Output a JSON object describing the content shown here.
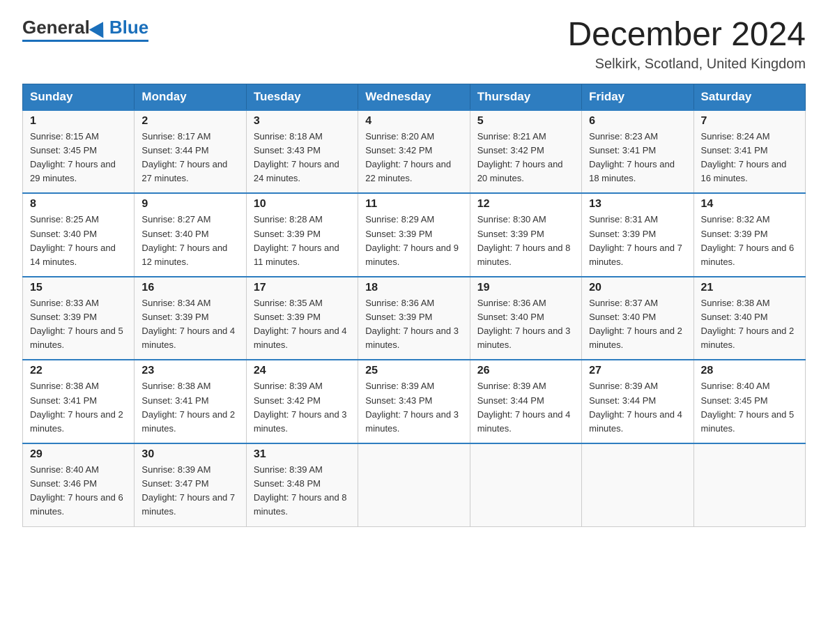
{
  "header": {
    "logo_general": "General",
    "logo_blue": "Blue",
    "main_title": "December 2024",
    "subtitle": "Selkirk, Scotland, United Kingdom"
  },
  "days_of_week": [
    "Sunday",
    "Monday",
    "Tuesday",
    "Wednesday",
    "Thursday",
    "Friday",
    "Saturday"
  ],
  "weeks": [
    [
      {
        "day": "1",
        "sunrise": "8:15 AM",
        "sunset": "3:45 PM",
        "daylight": "7 hours and 29 minutes."
      },
      {
        "day": "2",
        "sunrise": "8:17 AM",
        "sunset": "3:44 PM",
        "daylight": "7 hours and 27 minutes."
      },
      {
        "day": "3",
        "sunrise": "8:18 AM",
        "sunset": "3:43 PM",
        "daylight": "7 hours and 24 minutes."
      },
      {
        "day": "4",
        "sunrise": "8:20 AM",
        "sunset": "3:42 PM",
        "daylight": "7 hours and 22 minutes."
      },
      {
        "day": "5",
        "sunrise": "8:21 AM",
        "sunset": "3:42 PM",
        "daylight": "7 hours and 20 minutes."
      },
      {
        "day": "6",
        "sunrise": "8:23 AM",
        "sunset": "3:41 PM",
        "daylight": "7 hours and 18 minutes."
      },
      {
        "day": "7",
        "sunrise": "8:24 AM",
        "sunset": "3:41 PM",
        "daylight": "7 hours and 16 minutes."
      }
    ],
    [
      {
        "day": "8",
        "sunrise": "8:25 AM",
        "sunset": "3:40 PM",
        "daylight": "7 hours and 14 minutes."
      },
      {
        "day": "9",
        "sunrise": "8:27 AM",
        "sunset": "3:40 PM",
        "daylight": "7 hours and 12 minutes."
      },
      {
        "day": "10",
        "sunrise": "8:28 AM",
        "sunset": "3:39 PM",
        "daylight": "7 hours and 11 minutes."
      },
      {
        "day": "11",
        "sunrise": "8:29 AM",
        "sunset": "3:39 PM",
        "daylight": "7 hours and 9 minutes."
      },
      {
        "day": "12",
        "sunrise": "8:30 AM",
        "sunset": "3:39 PM",
        "daylight": "7 hours and 8 minutes."
      },
      {
        "day": "13",
        "sunrise": "8:31 AM",
        "sunset": "3:39 PM",
        "daylight": "7 hours and 7 minutes."
      },
      {
        "day": "14",
        "sunrise": "8:32 AM",
        "sunset": "3:39 PM",
        "daylight": "7 hours and 6 minutes."
      }
    ],
    [
      {
        "day": "15",
        "sunrise": "8:33 AM",
        "sunset": "3:39 PM",
        "daylight": "7 hours and 5 minutes."
      },
      {
        "day": "16",
        "sunrise": "8:34 AM",
        "sunset": "3:39 PM",
        "daylight": "7 hours and 4 minutes."
      },
      {
        "day": "17",
        "sunrise": "8:35 AM",
        "sunset": "3:39 PM",
        "daylight": "7 hours and 4 minutes."
      },
      {
        "day": "18",
        "sunrise": "8:36 AM",
        "sunset": "3:39 PM",
        "daylight": "7 hours and 3 minutes."
      },
      {
        "day": "19",
        "sunrise": "8:36 AM",
        "sunset": "3:40 PM",
        "daylight": "7 hours and 3 minutes."
      },
      {
        "day": "20",
        "sunrise": "8:37 AM",
        "sunset": "3:40 PM",
        "daylight": "7 hours and 2 minutes."
      },
      {
        "day": "21",
        "sunrise": "8:38 AM",
        "sunset": "3:40 PM",
        "daylight": "7 hours and 2 minutes."
      }
    ],
    [
      {
        "day": "22",
        "sunrise": "8:38 AM",
        "sunset": "3:41 PM",
        "daylight": "7 hours and 2 minutes."
      },
      {
        "day": "23",
        "sunrise": "8:38 AM",
        "sunset": "3:41 PM",
        "daylight": "7 hours and 2 minutes."
      },
      {
        "day": "24",
        "sunrise": "8:39 AM",
        "sunset": "3:42 PM",
        "daylight": "7 hours and 3 minutes."
      },
      {
        "day": "25",
        "sunrise": "8:39 AM",
        "sunset": "3:43 PM",
        "daylight": "7 hours and 3 minutes."
      },
      {
        "day": "26",
        "sunrise": "8:39 AM",
        "sunset": "3:44 PM",
        "daylight": "7 hours and 4 minutes."
      },
      {
        "day": "27",
        "sunrise": "8:39 AM",
        "sunset": "3:44 PM",
        "daylight": "7 hours and 4 minutes."
      },
      {
        "day": "28",
        "sunrise": "8:40 AM",
        "sunset": "3:45 PM",
        "daylight": "7 hours and 5 minutes."
      }
    ],
    [
      {
        "day": "29",
        "sunrise": "8:40 AM",
        "sunset": "3:46 PM",
        "daylight": "7 hours and 6 minutes."
      },
      {
        "day": "30",
        "sunrise": "8:39 AM",
        "sunset": "3:47 PM",
        "daylight": "7 hours and 7 minutes."
      },
      {
        "day": "31",
        "sunrise": "8:39 AM",
        "sunset": "3:48 PM",
        "daylight": "7 hours and 8 minutes."
      },
      null,
      null,
      null,
      null
    ]
  ]
}
